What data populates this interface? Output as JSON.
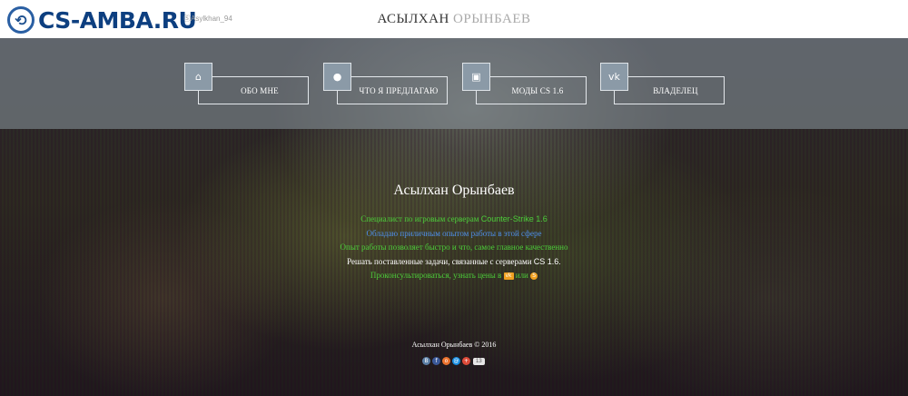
{
  "header": {
    "logo_text": "CS-AMBA.RU",
    "skype_handle": "Asylkhan_94",
    "title_first": "АСЫЛХАН",
    "title_last": "ОРЫНБАЕВ"
  },
  "nav": [
    {
      "label": "ОБО МНЕ",
      "icon": "home-icon"
    },
    {
      "label": "ЧТО Я ПРЕДЛАГАЮ",
      "icon": "user-icon"
    },
    {
      "label": "МОДЫ CS 1.6",
      "icon": "image-icon"
    },
    {
      "label": "ВЛАДЕЛЕЦ",
      "icon": "vk-icon"
    }
  ],
  "main": {
    "name": "Асылхан Орынбаев",
    "line1_text": "Специалист по игровым серверам ",
    "line1_highlight": "Counter-Strike 1.6",
    "line2": "Обладаю приличным опытом работы в этой сфере",
    "line3": "Опыт работы позволяет быстро и что, самое главное качественно",
    "line4_text": "Решать поставленные задачи, связанные с серверами ",
    "line4_highlight": "CS 1.6.",
    "line5_text": "Проконсультироваться, узнать цены в ",
    "line5_or": " или "
  },
  "footer": {
    "copyright": "Асылхан Орынбаев © 2016",
    "share_count": "13"
  },
  "colors": {
    "accent_green": "#4ccd3a",
    "accent_blue": "#4f8fe8",
    "logo_blue": "#0d3f80",
    "icon_orange": "#f0a020"
  }
}
